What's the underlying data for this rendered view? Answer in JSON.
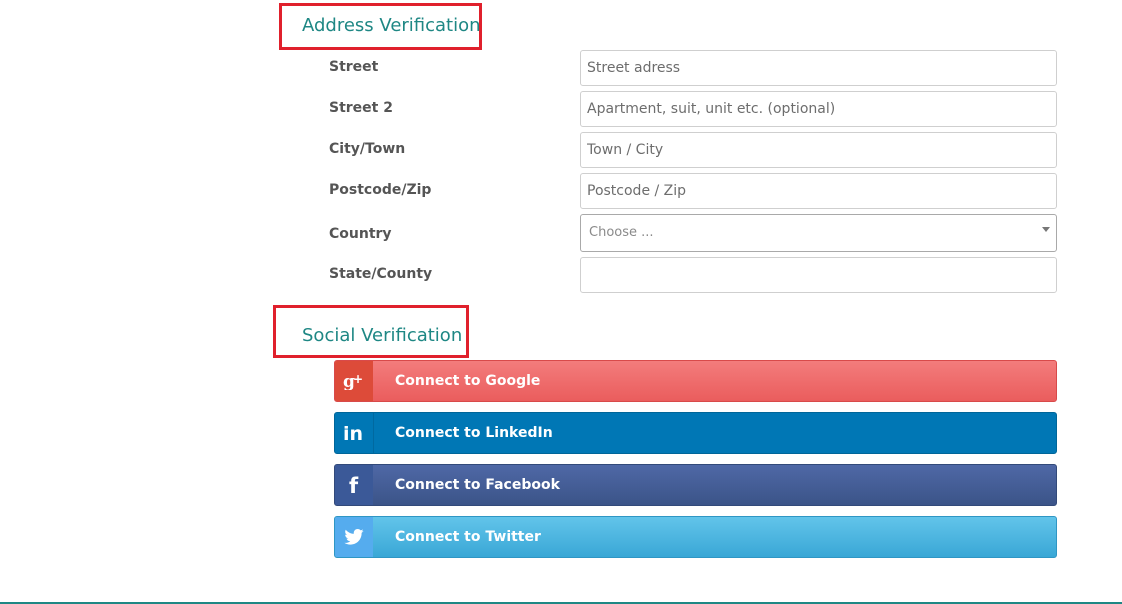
{
  "address_section": {
    "title": "Address Verification",
    "fields": [
      {
        "label": "Street",
        "placeholder": "Street adress",
        "value": ""
      },
      {
        "label": "Street 2",
        "placeholder": "Apartment, suit, unit etc. (optional)",
        "value": ""
      },
      {
        "label": "City/Town",
        "placeholder": "Town / City",
        "value": ""
      },
      {
        "label": "Postcode/Zip",
        "placeholder": "Postcode / Zip",
        "value": ""
      },
      {
        "label": "Country",
        "selected": "Choose ..."
      },
      {
        "label": "State/County",
        "placeholder": "",
        "value": ""
      }
    ]
  },
  "social_section": {
    "title": "Social Verification",
    "buttons": [
      {
        "label": "Connect to Google",
        "icon": "google-plus-icon",
        "color": "#ea5d5d"
      },
      {
        "label": "Connect to LinkedIn",
        "icon": "linkedin-icon",
        "color": "#0077b5"
      },
      {
        "label": "Connect to Facebook",
        "icon": "facebook-icon",
        "color": "#3b5998"
      },
      {
        "label": "Connect to Twitter",
        "icon": "twitter-icon",
        "color": "#55acee"
      }
    ]
  },
  "colors": {
    "accent": "#1e8784",
    "highlight_border": "#e0202c"
  }
}
